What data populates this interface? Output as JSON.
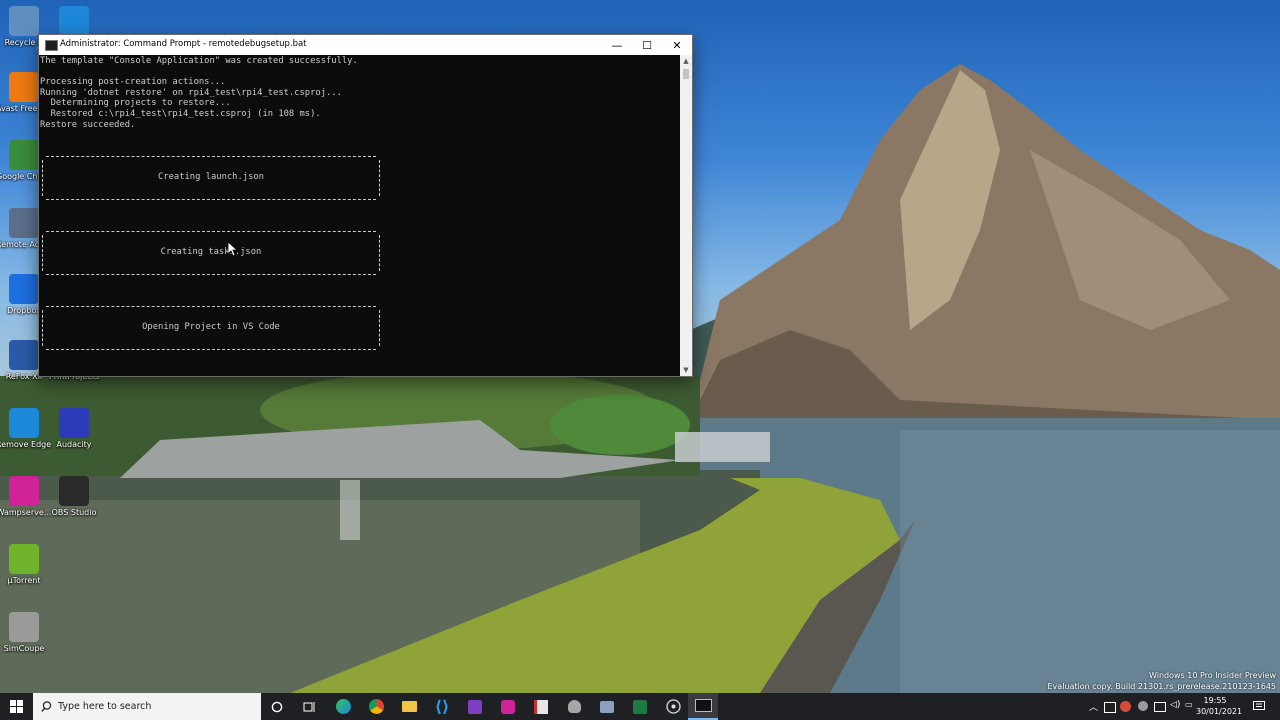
{
  "window": {
    "title": "Administrator: Command Prompt - remotedebugsetup.bat",
    "minimize": "—",
    "maximize": "☐",
    "close": "✕",
    "console_lines": "The template \"Console Application\" was created successfully.\n\nProcessing post-creation actions...\nRunning 'dotnet restore' on rpi4_test\\rpi4_test.csproj...\n  Determining projects to restore...\n  Restored c:\\rpi4_test\\rpi4_test.csproj (in 108 ms).\nRestore succeeded.",
    "boxes": [
      {
        "text": "Creating launch.json"
      },
      {
        "text": "Creating tasks.json"
      },
      {
        "text": "Opening Project in VS Code"
      }
    ]
  },
  "desktop_icons": [
    {
      "label": "Recycle B",
      "icon": "recycle-bin-icon",
      "color": "#5f8fbf"
    },
    {
      "label": "",
      "icon": "edge-icon",
      "color": "#1e88d8"
    },
    {
      "label": "Avast Free Antivirus",
      "icon": "avast-icon",
      "color": "#f07a12"
    },
    {
      "label": "Google Chrome",
      "icon": "chrome-icon",
      "color": "#3b8d3e"
    },
    {
      "label": "Remote Access",
      "icon": "remote-access-icon",
      "color": "#5b6f8c"
    },
    {
      "label": "Dropbox",
      "icon": "dropbox-icon",
      "color": "#1e6fe0"
    },
    {
      "label": "ReFox XII",
      "icon": "refox-icon",
      "color": "#2b5ba8"
    },
    {
      "label": "PrintProjects",
      "icon": "printprojects-icon",
      "color": "#3a6a8a"
    },
    {
      "label": "Remove Edge Appxfnl",
      "icon": "edge-icon",
      "color": "#1e88d8"
    },
    {
      "label": "Audacity",
      "icon": "audacity-icon",
      "color": "#2a3ab8"
    },
    {
      "label": "Wampserve...",
      "icon": "wampserver-icon",
      "color": "#d0239a"
    },
    {
      "label": "OBS Studio",
      "icon": "obs-icon",
      "color": "#2a2a2a"
    },
    {
      "label": "µTorrent",
      "icon": "utorrent-icon",
      "color": "#6fb32a"
    },
    {
      "label": "SimCoupe",
      "icon": "simcoupe-icon",
      "color": "#9a9a9a"
    }
  ],
  "watermark": {
    "line1": "Windows 10 Pro Insider Preview",
    "line2": "Evaluation copy. Build 21301.rs_prerelease.210123-1645"
  },
  "taskbar": {
    "search_placeholder": "Type here to search",
    "time": "19:55",
    "date": "30/01/2021"
  }
}
